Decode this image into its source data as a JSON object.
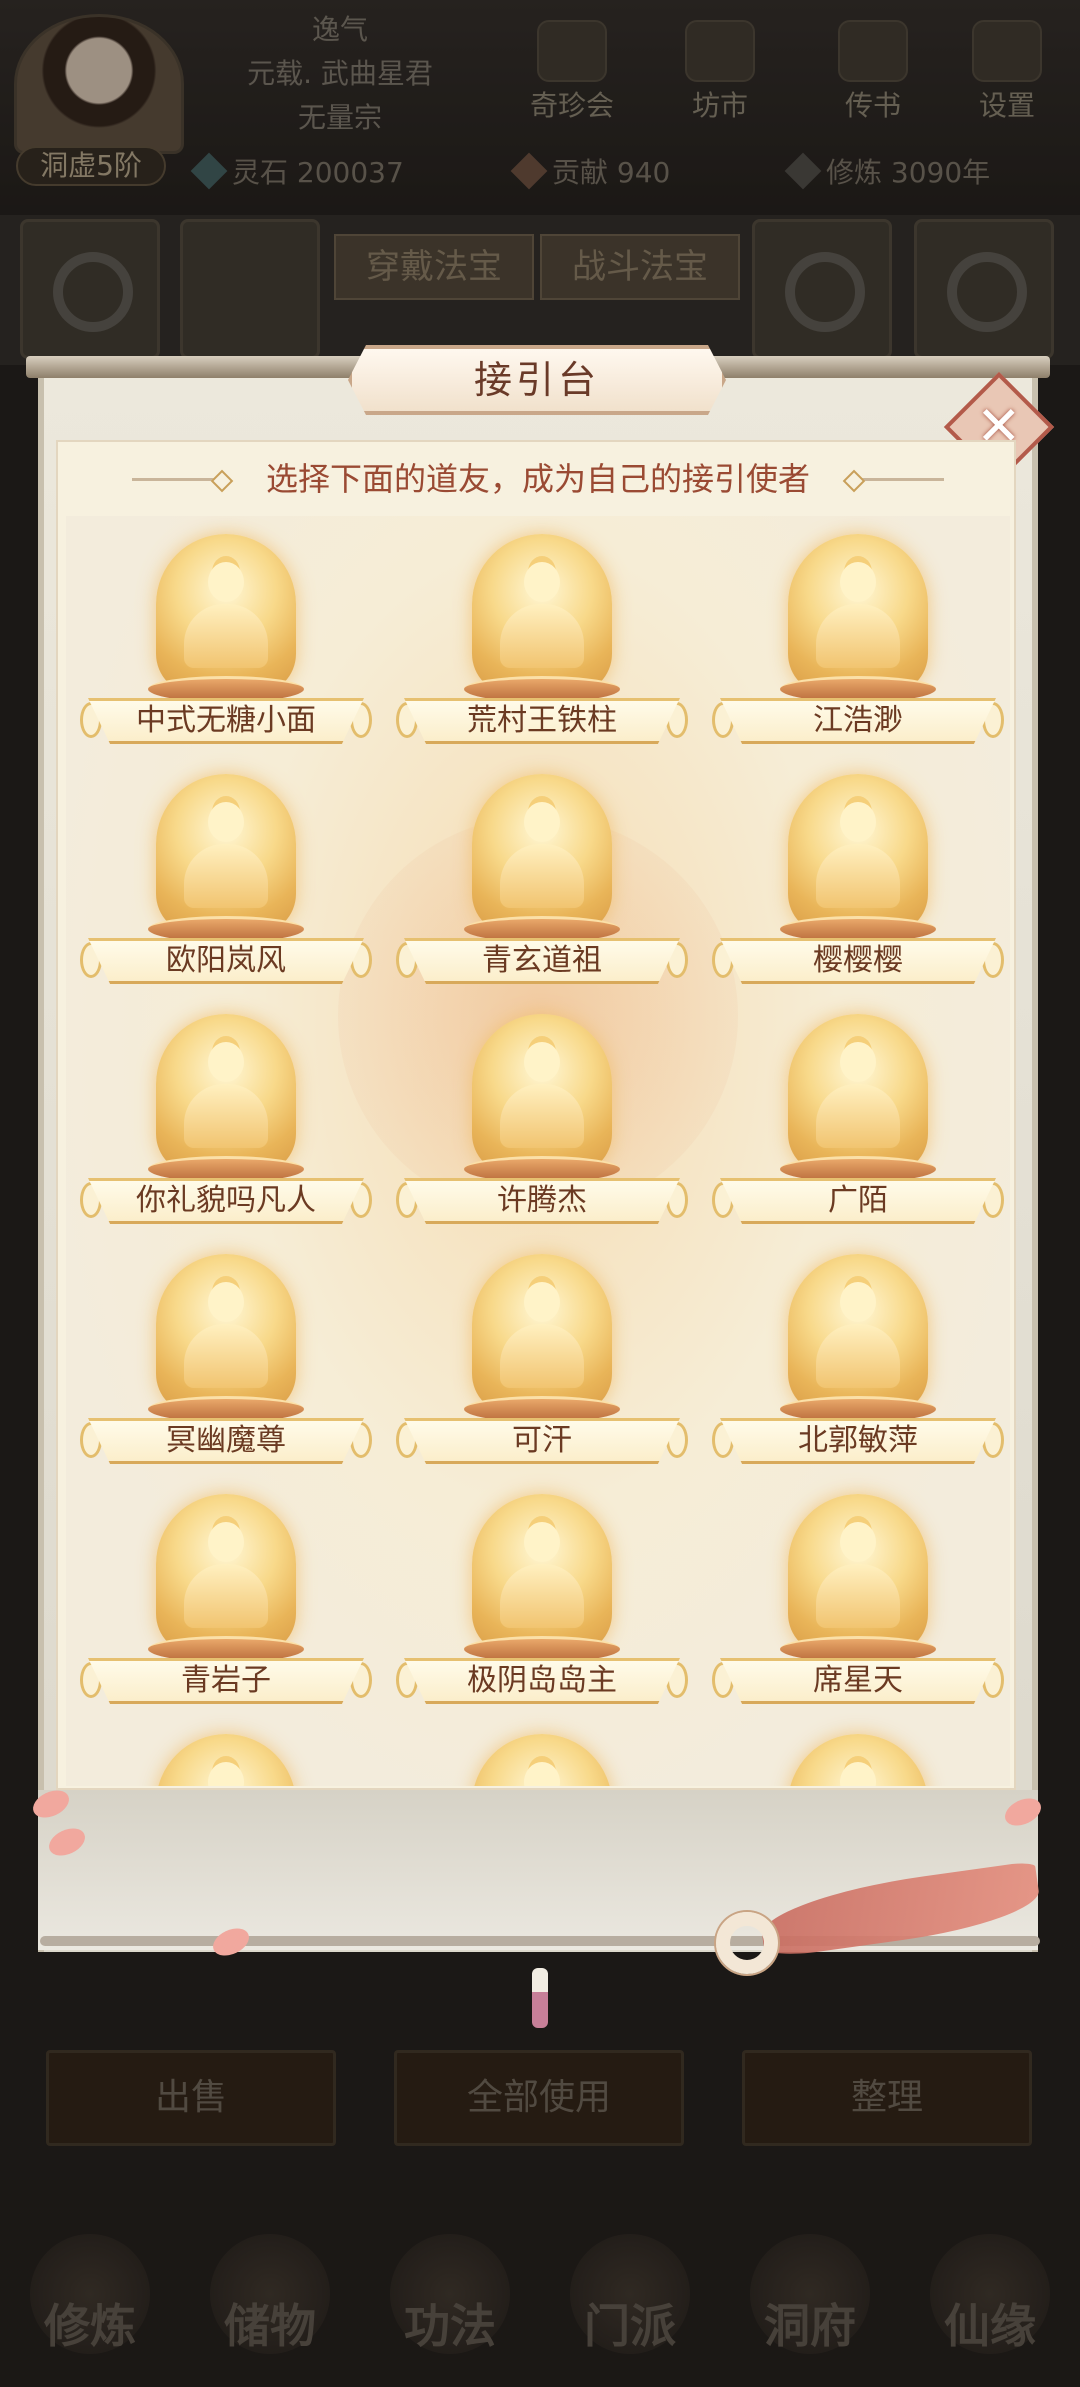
{
  "player": {
    "name": "逸气",
    "title": "元载. 武曲星君",
    "sect": "无量宗",
    "realm": "洞虚5阶"
  },
  "top_nav": [
    {
      "label": "奇珍会",
      "icon": "treasure-pavilion-icon"
    },
    {
      "label": "坊市",
      "icon": "market-icon"
    },
    {
      "label": "传书",
      "icon": "letter-icon"
    },
    {
      "label": "设置",
      "icon": "gear-icon"
    }
  ],
  "resources": {
    "spirit_stone": "灵石 200037",
    "contribution": "贡献 940",
    "cultivation": "修炼 3090年"
  },
  "inventory_tabs": {
    "equip": "穿戴法宝",
    "battle": "战斗法宝"
  },
  "bottom_actions": {
    "sell": "出售",
    "use_all": "全部使用",
    "organize": "整理"
  },
  "bottom_nav": [
    {
      "label": "修炼"
    },
    {
      "label": "储物"
    },
    {
      "label": "功法"
    },
    {
      "label": "门派"
    },
    {
      "label": "洞府"
    },
    {
      "label": "仙缘"
    }
  ],
  "modal": {
    "title": "接引台",
    "subtitle": "选择下面的道友，成为自己的接引使者",
    "close": "✕",
    "envoys": [
      "中式无糖小面",
      "荒村王铁柱",
      "江浩渺",
      "欧阳岚风",
      "青玄道祖",
      "樱樱樱",
      "你礼貌吗凡人",
      "许腾杰",
      "广陌",
      "冥幽魔尊",
      "可汗",
      "北郭敏萍",
      "青岩子",
      "极阴岛岛主",
      "席星天"
    ]
  },
  "colors": {
    "accent_title": "#6a3a28",
    "subtitle_text": "#9a4a33",
    "close_border": "#b35a4a",
    "statue_gold": "#f1c470"
  }
}
